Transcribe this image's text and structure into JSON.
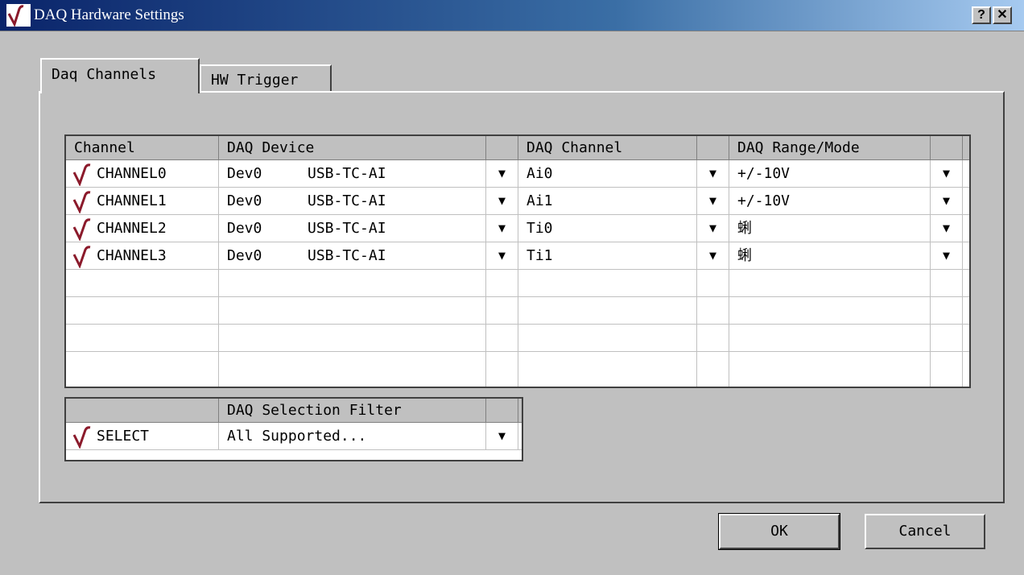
{
  "window": {
    "title": "DAQ Hardware Settings",
    "help_label": "?",
    "close_label": "✕"
  },
  "tabs": [
    {
      "label": "Daq Channels"
    },
    {
      "label": "HW Trigger"
    }
  ],
  "channel_table": {
    "headers": {
      "channel": "Channel",
      "device": "DAQ Device",
      "daq_channel": "DAQ Channel",
      "range_mode": "DAQ Range/Mode"
    },
    "dropdown_glyph": "▼",
    "rows": [
      {
        "channel": "CHANNEL0",
        "device": "Dev0",
        "model": "USB-TC-AI",
        "daq_channel": "Ai0",
        "range_mode": "+/-10V"
      },
      {
        "channel": "CHANNEL1",
        "device": "Dev0",
        "model": "USB-TC-AI",
        "daq_channel": "Ai1",
        "range_mode": "+/-10V"
      },
      {
        "channel": "CHANNEL2",
        "device": "Dev0",
        "model": "USB-TC-AI",
        "daq_channel": "Ti0",
        "range_mode": "蜊"
      },
      {
        "channel": "CHANNEL3",
        "device": "Dev0",
        "model": "USB-TC-AI",
        "daq_channel": "Ti1",
        "range_mode": "蜊"
      }
    ]
  },
  "filter_table": {
    "header": "DAQ Selection Filter",
    "row": {
      "name": "SELECT",
      "value": "All Supported..."
    }
  },
  "buttons": {
    "ok": "OK",
    "cancel": "Cancel"
  },
  "colors": {
    "icon_red": "#8b1a2b",
    "title_start": "#0a246a",
    "title_end": "#a6caf0"
  }
}
